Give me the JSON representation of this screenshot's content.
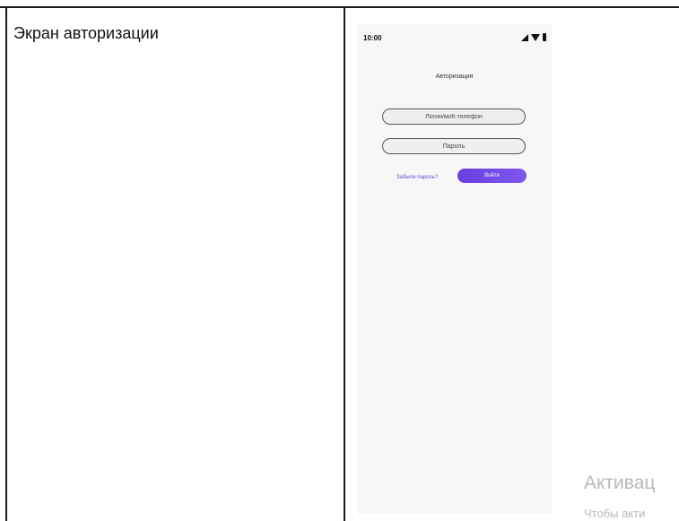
{
  "left_cell": {
    "title": "Экран авторизации"
  },
  "phone": {
    "status_bar": {
      "time": "10:00",
      "icons": [
        "signal-icon",
        "wifi-icon",
        "battery-icon"
      ]
    },
    "screen_title": "Авторизация",
    "login_field": {
      "placeholder": "Логин/моб.телефон",
      "value": ""
    },
    "password_field": {
      "placeholder": "Пароль",
      "value": ""
    },
    "forgot_link": "Забыли пароль?",
    "submit_button": "Войти"
  },
  "watermark": {
    "title": "Активац",
    "subtitle": "Чтобы акти"
  },
  "colors": {
    "accent": "#6a3fe0",
    "link": "#6b4fd8",
    "screen_background": "#f7f7f7"
  }
}
